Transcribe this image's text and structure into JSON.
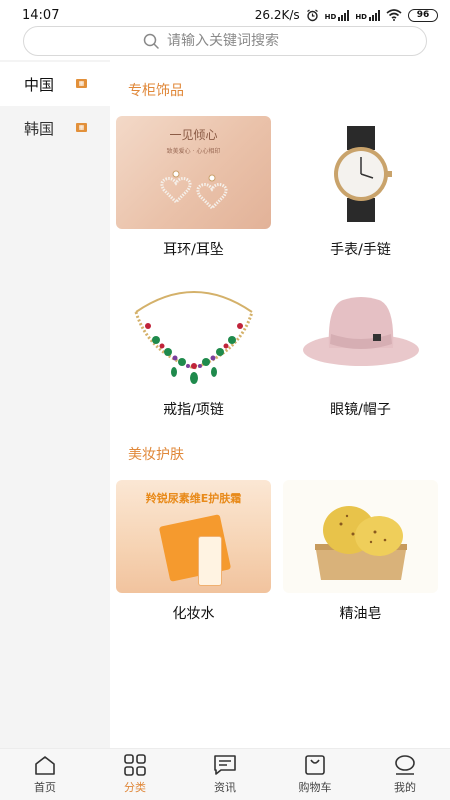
{
  "status_bar": {
    "time": "14:07",
    "network_speed": "26.2K/s",
    "signal_1": "HD",
    "signal_2": "HD",
    "battery": "96"
  },
  "search": {
    "placeholder": "请输入关键词搜索"
  },
  "sidebar": {
    "items": [
      {
        "label": "中国",
        "active": true
      },
      {
        "label": "韩国",
        "active": false
      }
    ]
  },
  "sections": [
    {
      "title": "专柜饰品",
      "items": [
        {
          "label": "耳环/耳坠",
          "image_caption": "一见倾心",
          "image_sub": "致美爱心 · 心心相印"
        },
        {
          "label": "手表/手链"
        },
        {
          "label": "戒指/项链"
        },
        {
          "label": "眼镜/帽子"
        }
      ]
    },
    {
      "title": "美妆护肤",
      "items": [
        {
          "label": "化妆水",
          "image_caption": "羚锐尿素维E护肤霜"
        },
        {
          "label": "精油皂"
        }
      ]
    }
  ],
  "tabbar": {
    "tabs": [
      {
        "label": "首页",
        "icon": "home-icon"
      },
      {
        "label": "分类",
        "icon": "category-icon",
        "active": true
      },
      {
        "label": "资讯",
        "icon": "news-icon"
      },
      {
        "label": "购物车",
        "icon": "cart-icon"
      },
      {
        "label": "我的",
        "icon": "profile-icon"
      }
    ]
  },
  "colors": {
    "accent": "#e0883a",
    "sidebar_bg": "#f4f4f4"
  }
}
